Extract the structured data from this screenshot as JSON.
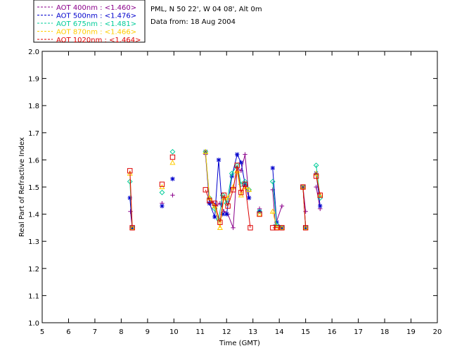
{
  "header": {
    "site": "PML, N 50 22', W 04 08', Alt 0m",
    "date": "Data from: 18 Aug 2004"
  },
  "chart_data": {
    "type": "line",
    "xlabel": "Time (GMT)",
    "ylabel": "Real Part of Refractive Index",
    "xlim": [
      5,
      20
    ],
    "ylim": [
      1.0,
      2.0
    ],
    "xticks": [
      "5",
      "6",
      "7",
      "8",
      "9",
      "10",
      "11",
      "12",
      "13",
      "14",
      "15",
      "16",
      "17",
      "18",
      "19",
      "20"
    ],
    "yticks": [
      "1.0",
      "1.1",
      "1.2",
      "1.3",
      "1.4",
      "1.5",
      "1.6",
      "1.7",
      "1.8",
      "1.9",
      "2.0"
    ],
    "grid": false,
    "legend_position": "top-left",
    "series": [
      {
        "name": "AOT  400nm : <1.460>",
        "color": "#8b008b",
        "marker": "plus",
        "segments": [
          [
            [
              8.35,
              1.41
            ],
            [
              8.42,
              1.35
            ]
          ],
          [
            [
              9.55,
              1.44
            ]
          ],
          [
            [
              9.95,
              1.47
            ]
          ],
          [
            [
              11.2,
              1.62
            ],
            [
              11.35,
              1.44
            ],
            [
              11.5,
              1.44
            ],
            [
              11.6,
              1.43
            ],
            [
              11.75,
              1.44
            ],
            [
              11.9,
              1.41
            ],
            [
              12.05,
              1.4
            ],
            [
              12.25,
              1.35
            ],
            [
              12.4,
              1.57
            ],
            [
              12.55,
              1.56
            ],
            [
              12.7,
              1.62
            ],
            [
              12.85,
              1.46
            ]
          ],
          [
            [
              13.25,
              1.42
            ]
          ],
          [
            [
              13.75,
              1.49
            ],
            [
              13.85,
              1.36
            ],
            [
              14.1,
              1.43
            ]
          ],
          [
            [
              14.9,
              1.5
            ],
            [
              15.0,
              1.41
            ]
          ],
          [
            [
              15.4,
              1.5
            ],
            [
              15.55,
              1.42
            ]
          ]
        ]
      },
      {
        "name": "AOT  500nm : <1.476>",
        "color": "#0000cd",
        "marker": "star",
        "segments": [
          [
            [
              8.33,
              1.46
            ],
            [
              8.42,
              1.35
            ]
          ],
          [
            [
              9.55,
              1.43
            ]
          ],
          [
            [
              9.95,
              1.53
            ]
          ],
          [
            [
              11.2,
              1.63
            ],
            [
              11.35,
              1.44
            ],
            [
              11.55,
              1.39
            ],
            [
              11.7,
              1.6
            ],
            [
              11.85,
              1.4
            ],
            [
              12.0,
              1.4
            ],
            [
              12.2,
              1.54
            ],
            [
              12.4,
              1.62
            ],
            [
              12.55,
              1.59
            ],
            [
              12.7,
              1.51
            ],
            [
              12.85,
              1.46
            ]
          ],
          [
            [
              13.25,
              1.41
            ]
          ],
          [
            [
              13.75,
              1.57
            ],
            [
              13.9,
              1.37
            ],
            [
              14.1,
              1.35
            ]
          ],
          [
            [
              14.9,
              1.5
            ],
            [
              15.0,
              1.35
            ]
          ],
          [
            [
              15.4,
              1.55
            ],
            [
              15.55,
              1.43
            ]
          ]
        ]
      },
      {
        "name": "AOT  675nm : <1.481>",
        "color": "#00cc99",
        "marker": "diamond",
        "segments": [
          [
            [
              8.33,
              1.52
            ],
            [
              8.42,
              1.35
            ]
          ],
          [
            [
              9.55,
              1.48
            ]
          ],
          [
            [
              9.95,
              1.63
            ]
          ],
          [
            [
              11.2,
              1.63
            ],
            [
              11.35,
              1.46
            ],
            [
              11.55,
              1.42
            ],
            [
              11.7,
              1.38
            ],
            [
              11.85,
              1.47
            ],
            [
              12.0,
              1.44
            ],
            [
              12.2,
              1.55
            ],
            [
              12.4,
              1.58
            ],
            [
              12.55,
              1.51
            ],
            [
              12.7,
              1.52
            ],
            [
              12.85,
              1.49
            ]
          ],
          [
            [
              13.25,
              1.41
            ]
          ],
          [
            [
              13.75,
              1.52
            ],
            [
              13.9,
              1.36
            ],
            [
              14.1,
              1.35
            ]
          ],
          [
            [
              14.9,
              1.5
            ],
            [
              15.0,
              1.35
            ]
          ],
          [
            [
              15.4,
              1.58
            ],
            [
              15.55,
              1.46
            ]
          ]
        ]
      },
      {
        "name": "AOT  870nm : <1.466>",
        "color": "#ffcc00",
        "marker": "triangle",
        "segments": [
          [
            [
              8.33,
              1.55
            ],
            [
              8.42,
              1.35
            ]
          ],
          [
            [
              9.55,
              1.5
            ]
          ],
          [
            [
              9.95,
              1.59
            ]
          ],
          [
            [
              11.2,
              1.63
            ],
            [
              11.35,
              1.46
            ],
            [
              11.55,
              1.43
            ],
            [
              11.75,
              1.35
            ],
            [
              11.9,
              1.46
            ],
            [
              12.05,
              1.46
            ],
            [
              12.25,
              1.5
            ],
            [
              12.4,
              1.56
            ],
            [
              12.55,
              1.47
            ],
            [
              12.7,
              1.5
            ],
            [
              12.85,
              1.49
            ]
          ],
          [
            [
              13.25,
              1.4
            ]
          ],
          [
            [
              13.75,
              1.41
            ],
            [
              13.9,
              1.35
            ],
            [
              14.1,
              1.35
            ]
          ],
          [
            [
              14.9,
              1.5
            ],
            [
              15.0,
              1.35
            ]
          ],
          [
            [
              15.4,
              1.55
            ],
            [
              15.55,
              1.47
            ]
          ]
        ]
      },
      {
        "name": "AOT 1020nm : <1.464>",
        "color": "#dd0000",
        "marker": "square",
        "segments": [
          [
            [
              8.33,
              1.56
            ],
            [
              8.42,
              1.35
            ]
          ],
          [
            [
              9.55,
              1.51
            ]
          ],
          [
            [
              9.95,
              1.61
            ]
          ],
          [
            [
              11.2,
              1.49
            ],
            [
              11.35,
              1.45
            ],
            [
              11.55,
              1.44
            ],
            [
              11.75,
              1.37
            ],
            [
              11.9,
              1.47
            ],
            [
              12.05,
              1.43
            ],
            [
              12.25,
              1.49
            ],
            [
              12.4,
              1.58
            ],
            [
              12.55,
              1.48
            ],
            [
              12.7,
              1.51
            ],
            [
              12.9,
              1.35
            ]
          ],
          [
            [
              13.25,
              1.4
            ]
          ],
          [
            [
              13.75,
              1.35
            ],
            [
              13.9,
              1.35
            ],
            [
              14.1,
              1.35
            ]
          ],
          [
            [
              14.9,
              1.5
            ],
            [
              15.0,
              1.35
            ]
          ],
          [
            [
              15.4,
              1.54
            ],
            [
              15.55,
              1.47
            ]
          ]
        ]
      }
    ]
  }
}
